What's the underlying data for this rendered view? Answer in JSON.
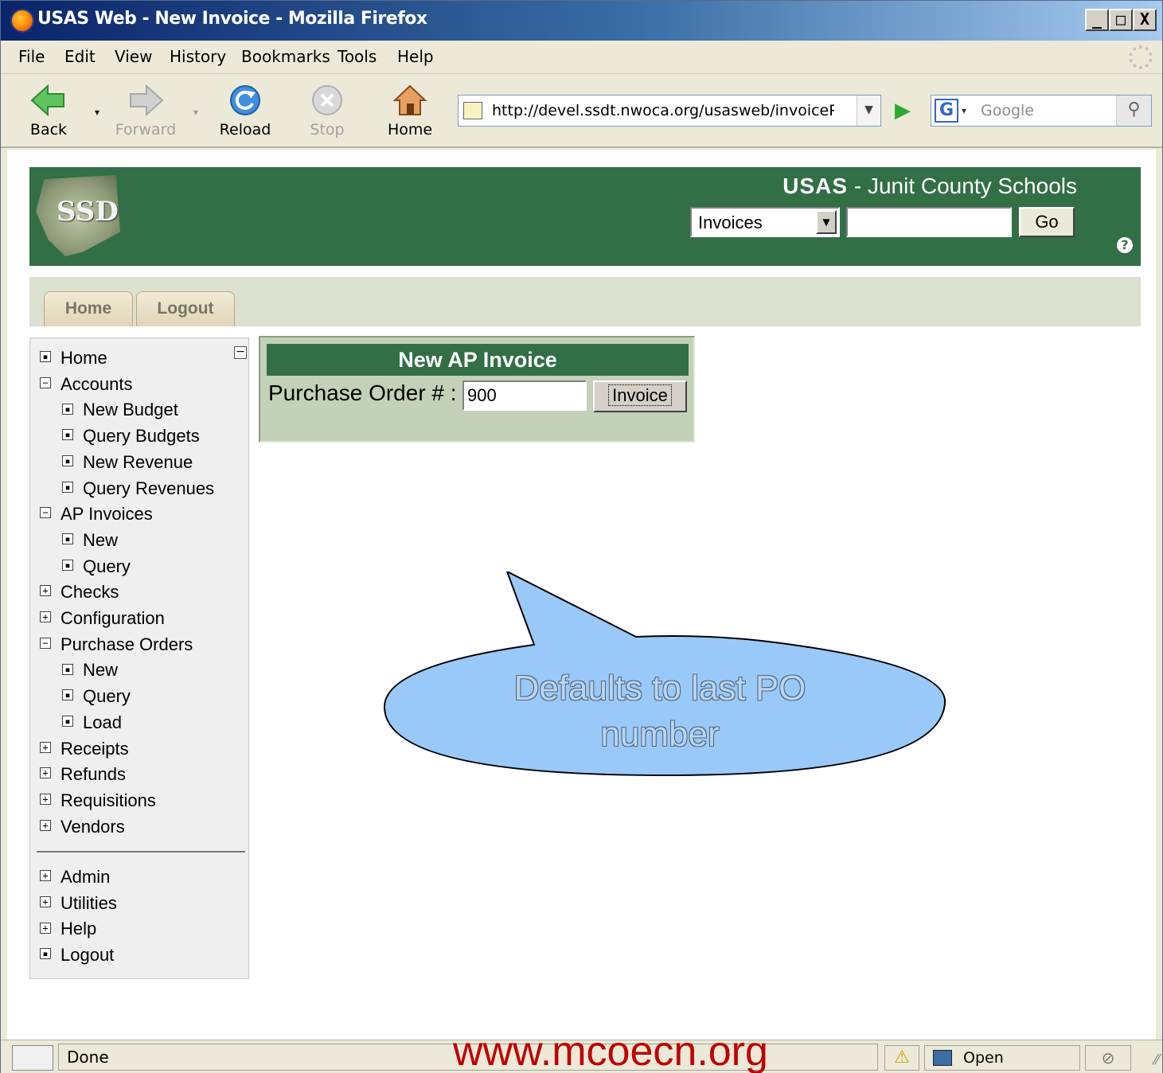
{
  "window": {
    "title": "USAS Web - New Invoice - Mozilla Firefox",
    "controls": [
      "_",
      "□",
      "X"
    ]
  },
  "menubar": [
    "File",
    "Edit",
    "View",
    "History",
    "Bookmarks",
    "Tools",
    "Help"
  ],
  "toolbar": {
    "back": "Back",
    "forward": "Forward",
    "reload": "Reload",
    "stop": "Stop",
    "home": "Home",
    "url": "http://devel.ssdt.nwoca.org/usasweb/invoicePOFor",
    "search_placeholder": "Google"
  },
  "banner": {
    "logo_text": "SSDT",
    "app_name": "USAS",
    "app_suffix": " - Junit County Schools",
    "quick_select_value": "Invoices",
    "go_label": "Go",
    "help_glyph": "?"
  },
  "tabs": [
    "Home",
    "Logout"
  ],
  "sidebar": {
    "items": [
      {
        "label": "Home",
        "marker": "▪",
        "indent": 0
      },
      {
        "label": "Accounts",
        "marker": "−",
        "indent": 0
      },
      {
        "label": "New Budget",
        "marker": "▪",
        "indent": 1
      },
      {
        "label": "Query Budgets",
        "marker": "▪",
        "indent": 1
      },
      {
        "label": "New Revenue",
        "marker": "▪",
        "indent": 1
      },
      {
        "label": "Query Revenues",
        "marker": "▪",
        "indent": 1
      },
      {
        "label": "AP Invoices",
        "marker": "−",
        "indent": 0
      },
      {
        "label": "New",
        "marker": "▪",
        "indent": 1
      },
      {
        "label": "Query",
        "marker": "▪",
        "indent": 1
      },
      {
        "label": "Checks",
        "marker": "+",
        "indent": 0
      },
      {
        "label": "Configuration",
        "marker": "+",
        "indent": 0
      },
      {
        "label": "Purchase Orders",
        "marker": "−",
        "indent": 0
      },
      {
        "label": "New",
        "marker": "▪",
        "indent": 1
      },
      {
        "label": "Query",
        "marker": "▪",
        "indent": 1
      },
      {
        "label": "Load",
        "marker": "▪",
        "indent": 1
      },
      {
        "label": "Receipts",
        "marker": "+",
        "indent": 0
      },
      {
        "label": "Refunds",
        "marker": "+",
        "indent": 0
      },
      {
        "label": "Requisitions",
        "marker": "+",
        "indent": 0
      },
      {
        "label": "Vendors",
        "marker": "+",
        "indent": 0
      }
    ],
    "bottom_items": [
      {
        "label": "Admin",
        "marker": "+"
      },
      {
        "label": "Utilities",
        "marker": "+"
      },
      {
        "label": "Help",
        "marker": "+"
      },
      {
        "label": "Logout",
        "marker": "▪"
      }
    ]
  },
  "invoice_panel": {
    "heading": "New AP Invoice",
    "po_label": "Purchase Order # :",
    "po_value": "900",
    "submit_label": "Invoice"
  },
  "callout": {
    "line1": "Defaults to last PO",
    "line2": "number"
  },
  "statusbar": {
    "status": "Done",
    "notebook": "Open Notebook"
  },
  "watermark": "www.mcoecn.org"
}
